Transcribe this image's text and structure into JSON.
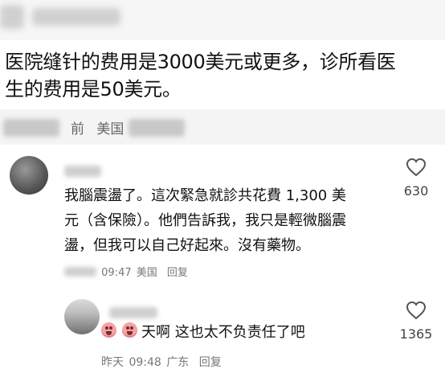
{
  "post": {
    "text": "医院缝针的费用是3000美元或更多，诊所看医\n生的费用是50美元。",
    "meta_time": "前",
    "meta_location": "美国"
  },
  "comment1": {
    "text": "我腦震盪了。這次緊急就診共花費 1,300 美\n元（含保險）。他們告訴我，我只是輕微腦震\n盪，但我可以自己好起來。沒有藥物。",
    "time": "09:47",
    "location": "美国",
    "reply_label": "回复",
    "likes": "630"
  },
  "comment2": {
    "text": "天啊 这也太不负责任了吧",
    "date": "昨天",
    "time": "09:48",
    "location": "广东",
    "reply_label": "回复",
    "likes": "1365"
  },
  "icons": {
    "like": "heart-outline-icon",
    "emoji": "crying-face-emoji-icon"
  },
  "colors": {
    "text": "#111111",
    "muted": "#777777",
    "emoji": "#f3a3a5"
  }
}
